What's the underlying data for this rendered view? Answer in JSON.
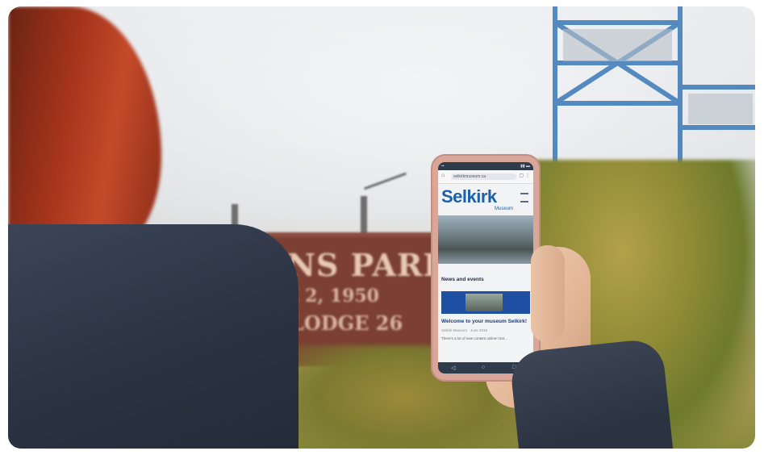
{
  "scene": {
    "description_colors": {
      "sky": "#e6e8eb",
      "sign": "#7b3f33",
      "hair": "#a8351c",
      "coat": "#2c3444",
      "phone_case": "#d9a69a"
    }
  },
  "sign": {
    "line1": "QUEENS PARK",
    "line2": "JUNE 2, 1950",
    "line3": "ORD LODGE 26",
    "line4": "... ..."
  },
  "phone": {
    "url": "selkirkmuseum.ca",
    "logo_main": "Selkirk",
    "logo_sub": "Museum",
    "section_title": "News and events",
    "post_title": "Welcome to your museum Selkirk!",
    "post_meta": "Selkirk Museum · June 2019",
    "post_excerpt": "There's a lot of new content online! Get...",
    "nav_back": "◁",
    "nav_home": "○",
    "nav_recent": "□"
  }
}
